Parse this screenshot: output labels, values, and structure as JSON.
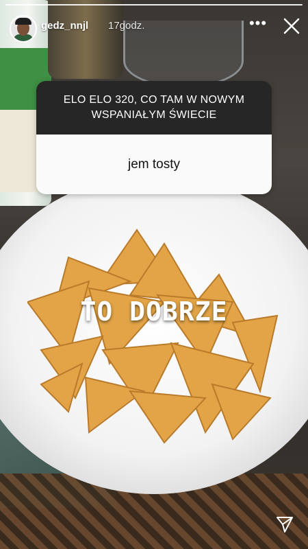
{
  "story": {
    "username": "gedz_nnjl",
    "time_ago": "17godz.",
    "more_icon": "more-horizontal-icon",
    "close_icon": "close-icon",
    "share_icon": "send-icon"
  },
  "question_sticker": {
    "question": "ELO ELO 320, CO TAM W NOWYM WSPANIAŁYM ŚWIECIE",
    "answer": "jem tosty"
  },
  "overlay": {
    "text": "TO DOBRZE"
  },
  "colors": {
    "sticker_header": "#262626",
    "sticker_body": "#fafafa",
    "chip": "#e2a446"
  }
}
